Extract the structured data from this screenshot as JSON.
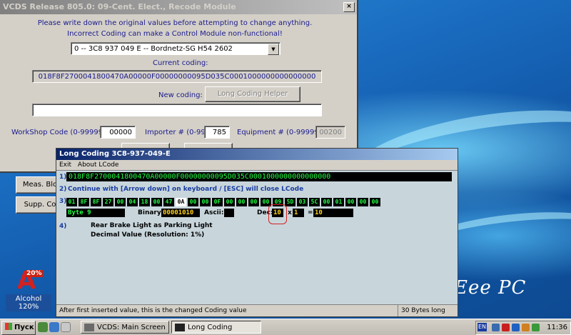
{
  "vcds": {
    "title": "VCDS Release 805.0: 09-Cent. Elect.,  Recode Module",
    "warning_line1": "Please write down the original values before attempting to change anything.",
    "warning_line2": "Incorrect Coding can make a Control Module non-functional!",
    "module_select": "0 -- 3C8 937 049 E -- Bordnetz-SG      H54 2602",
    "current_coding_label": "Current coding:",
    "current_coding_value": "018F8F2700041800470A00000F00000000095D035C0001000000000000000",
    "new_coding_label": "New coding:",
    "long_coding_helper_button": "Long Coding Helper",
    "new_coding_value": "",
    "workshop_label": "WorkShop Code (0-99999):",
    "workshop_value": "00000",
    "importer_label": "Importer # (0-999):",
    "importer_value": "785",
    "equipment_label": "Equipment # (0-99999):",
    "equipment_value": "00200",
    "meas_button": "Meas. Blo",
    "supp_button": "Supp. Co"
  },
  "long_coding": {
    "title": "Long Coding   3C8-937-049-E",
    "menu": [
      "Exit",
      "About LCode"
    ],
    "row1_num": "1)",
    "row1_value": "018F8F2700041800470A00000F00000000095D035C0001000000000000000",
    "row2_num": "2)",
    "row2_text": "Continue with [Arrow down] on keyboard / [ESC] will close LCode",
    "row3_num": "3)",
    "bytes": [
      "01",
      "8F",
      "8F",
      "27",
      "00",
      "04",
      "18",
      "00",
      "47",
      "0A",
      "00",
      "00",
      "0F",
      "00",
      "00",
      "00",
      "00",
      "09",
      "5D",
      "03",
      "5C",
      "00",
      "01",
      "00",
      "00",
      "00"
    ],
    "selected_byte_index": 9,
    "byte_name": "Byte 9",
    "binary_label": "Binary:",
    "binary_value": "00001010",
    "ascii_label": "Ascii:",
    "ascii_value": "",
    "dec_label": "Dec:",
    "dec_value": "10",
    "multiply_sign": "x",
    "multiplier_value": "1",
    "equals_sign": "=",
    "result_value": "10",
    "row4_num": "4)",
    "description_line1": "Rear Brake Light as Parking Light",
    "description_line2": "Decimal Value (Resolution: 1%)",
    "status_left": "After first inserted value, this is the changed Coding value",
    "status_right": "30 Bytes long"
  },
  "desktop": {
    "alcohol_label": "Alcohol 120%",
    "alcohol_badge": "20%",
    "brand": "Eee PC"
  },
  "taskbar": {
    "start_label": "Пуск",
    "tasks": [
      "VCDS:  Main Screen",
      "Long Coding"
    ],
    "lang": "EN",
    "clock": "11:36"
  }
}
